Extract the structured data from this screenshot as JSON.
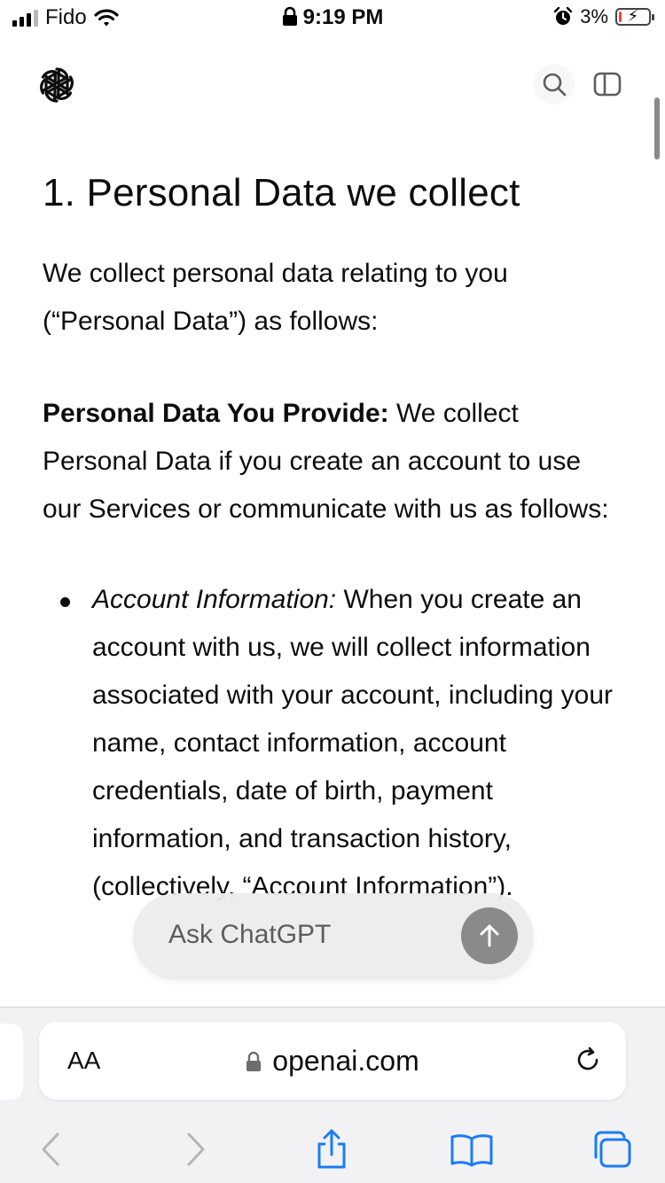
{
  "status_bar": {
    "carrier": "Fido",
    "time": "9:19 PM",
    "battery_percent": "3%",
    "battery_level": 0.03,
    "battery_color": "#e5473d"
  },
  "header": {
    "logo": "openai-logo",
    "search_icon": "search-icon",
    "sidebar_icon": "sidebar-icon"
  },
  "article": {
    "heading": "1. Personal Data we collect",
    "intro": "We collect personal data relating to you (“Personal Data”) as follows:",
    "provide_label": "Personal Data You Provide:",
    "provide_text": " We collect Personal Data if you create an account to use our Services or communicate with us as follows:",
    "bullets": [
      {
        "label": "Account Information:",
        "text": " When you create an account with us, we will collect information associated with your account, including your name, contact information, account credentials, date of birth, payment information, and transaction history, (collectively, “Account Information”)."
      }
    ]
  },
  "ask_chatgpt": {
    "placeholder": "Ask ChatGPT",
    "send_icon": "arrow-up-icon"
  },
  "browser": {
    "text_size_label": "AA",
    "url": "openai.com",
    "toolbar_icons": [
      "back-icon",
      "forward-icon",
      "share-icon",
      "bookmarks-icon",
      "tabs-icon"
    ]
  }
}
